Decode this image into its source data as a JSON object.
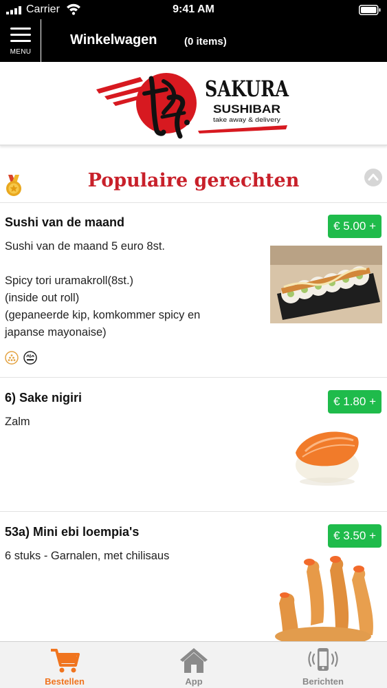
{
  "status_bar": {
    "carrier": "Carrier",
    "time": "9:41 AM"
  },
  "header": {
    "menu_label": "MENU",
    "title": "Winkelwagen",
    "cart_count": "(0 items)"
  },
  "logo": {
    "name": "SAKURA",
    "sub": "SUSHIBAR",
    "tagline": "take away & delivery"
  },
  "section": {
    "title": "Populaire gerechten"
  },
  "dishes": [
    {
      "name": "Sushi van de maand",
      "price": "€ 5.00 +",
      "description": "Sushi van de maand 5 euro 8st.\n\nSpicy tori uramakroll(8st.)\n(inside out roll)\n(gepaneerde kip, komkommer spicy en japanse mayonaise)"
    },
    {
      "name": "6)  Sake nigiri",
      "price": "€ 1.80 +",
      "description": "Zalm"
    },
    {
      "name": "53a)  Mini ebi loempia's",
      "price": "€ 3.50 +",
      "description": "6 stuks - Garnalen, met chilisaus"
    }
  ],
  "tabs": [
    {
      "label": "Bestellen",
      "icon": "cart-icon",
      "active": true
    },
    {
      "label": "App",
      "icon": "home-icon",
      "active": false
    },
    {
      "label": "Berichten",
      "icon": "phone-icon",
      "active": false
    }
  ],
  "colors": {
    "accent_red": "#c8202a",
    "price_green": "#1fbb4b",
    "tab_active": "#f0741e",
    "header_bg": "#000000"
  }
}
